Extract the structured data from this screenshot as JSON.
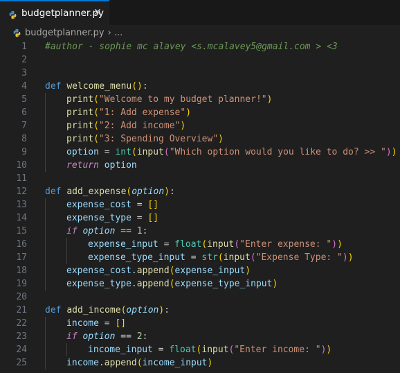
{
  "tab": {
    "filename": "budgetplanner.py",
    "close_glyph": "✕"
  },
  "breadcrumb": {
    "file": "budgetplanner.py",
    "separator": "›",
    "more": "..."
  },
  "editor": {
    "lines": [
      {
        "n": "1",
        "indent": 0,
        "tokens": [
          [
            "cmt",
            "#author - sophie mc alavey <s.mcalavey5@gmail.com > <3"
          ]
        ]
      },
      {
        "n": "2",
        "indent": 0,
        "tokens": []
      },
      {
        "n": "3",
        "indent": 0,
        "tokens": []
      },
      {
        "n": "4",
        "indent": 0,
        "tokens": [
          [
            "kw",
            "def"
          ],
          [
            "",
            " "
          ],
          [
            "fn",
            "welcome_menu"
          ],
          [
            "b1",
            "()"
          ],
          [
            "",
            ":"
          ]
        ]
      },
      {
        "n": "5",
        "indent": 1,
        "tokens": [
          [
            "fn",
            "print"
          ],
          [
            "b1",
            "("
          ],
          [
            "str",
            "\"Welcome to my budget planner!\""
          ],
          [
            "b1",
            ")"
          ]
        ]
      },
      {
        "n": "6",
        "indent": 1,
        "tokens": [
          [
            "fn",
            "print"
          ],
          [
            "b1",
            "("
          ],
          [
            "str",
            "\"1: Add expense\""
          ],
          [
            "b1",
            ")"
          ]
        ]
      },
      {
        "n": "7",
        "indent": 1,
        "tokens": [
          [
            "fn",
            "print"
          ],
          [
            "b1",
            "("
          ],
          [
            "str",
            "\"2: Add income\""
          ],
          [
            "b1",
            ")"
          ]
        ]
      },
      {
        "n": "8",
        "indent": 1,
        "tokens": [
          [
            "fn",
            "print"
          ],
          [
            "b1",
            "("
          ],
          [
            "str",
            "\"3: Spending Overview\""
          ],
          [
            "b1",
            ")"
          ]
        ]
      },
      {
        "n": "9",
        "indent": 1,
        "tokens": [
          [
            "var",
            "option"
          ],
          [
            "",
            " = "
          ],
          [
            "cls",
            "int"
          ],
          [
            "b1",
            "("
          ],
          [
            "fn",
            "input"
          ],
          [
            "b2",
            "("
          ],
          [
            "str",
            "\"Which option would you like to do? >> \""
          ],
          [
            "b2",
            ")"
          ],
          [
            "b1",
            ")"
          ]
        ]
      },
      {
        "n": "10",
        "indent": 1,
        "tokens": [
          [
            "ctl",
            "return"
          ],
          [
            "",
            " "
          ],
          [
            "var",
            "option"
          ]
        ]
      },
      {
        "n": "11",
        "indent": 0,
        "tokens": []
      },
      {
        "n": "12",
        "indent": 0,
        "tokens": [
          [
            "kw",
            "def"
          ],
          [
            "",
            " "
          ],
          [
            "fn",
            "add_expense"
          ],
          [
            "b1",
            "("
          ],
          [
            "param",
            "option"
          ],
          [
            "b1",
            ")"
          ],
          [
            "",
            ":"
          ]
        ]
      },
      {
        "n": "13",
        "indent": 1,
        "tokens": [
          [
            "var",
            "expense_cost"
          ],
          [
            "",
            " = "
          ],
          [
            "b1",
            "[]"
          ]
        ]
      },
      {
        "n": "14",
        "indent": 1,
        "tokens": [
          [
            "var",
            "expense_type"
          ],
          [
            "",
            " = "
          ],
          [
            "b1",
            "[]"
          ]
        ]
      },
      {
        "n": "15",
        "indent": 1,
        "tokens": [
          [
            "ctl",
            "if"
          ],
          [
            "",
            " "
          ],
          [
            "param",
            "option"
          ],
          [
            "",
            " == "
          ],
          [
            "num",
            "1"
          ],
          [
            "",
            ":"
          ]
        ]
      },
      {
        "n": "16",
        "indent": 2,
        "tokens": [
          [
            "var",
            "expense_input"
          ],
          [
            "",
            " = "
          ],
          [
            "cls",
            "float"
          ],
          [
            "b1",
            "("
          ],
          [
            "fn",
            "input"
          ],
          [
            "b2",
            "("
          ],
          [
            "str",
            "\"Enter expense: \""
          ],
          [
            "b2",
            ")"
          ],
          [
            "b1",
            ")"
          ]
        ]
      },
      {
        "n": "17",
        "indent": 2,
        "tokens": [
          [
            "var",
            "expense_type_input"
          ],
          [
            "",
            " = "
          ],
          [
            "cls",
            "str"
          ],
          [
            "b1",
            "("
          ],
          [
            "fn",
            "input"
          ],
          [
            "b2",
            "("
          ],
          [
            "str",
            "\"Expense Type: \""
          ],
          [
            "b2",
            ")"
          ],
          [
            "b1",
            ")"
          ]
        ]
      },
      {
        "n": "18",
        "indent": 1,
        "tokens": [
          [
            "var",
            "expense_cost"
          ],
          [
            "",
            "."
          ],
          [
            "fn",
            "append"
          ],
          [
            "b1",
            "("
          ],
          [
            "var",
            "expense_input"
          ],
          [
            "b1",
            ")"
          ]
        ]
      },
      {
        "n": "19",
        "indent": 1,
        "tokens": [
          [
            "var",
            "expense_type"
          ],
          [
            "",
            "."
          ],
          [
            "fn",
            "append"
          ],
          [
            "b1",
            "("
          ],
          [
            "var",
            "expense_type_input"
          ],
          [
            "b1",
            ")"
          ]
        ]
      },
      {
        "n": "20",
        "indent": 0,
        "tokens": []
      },
      {
        "n": "21",
        "indent": 0,
        "tokens": [
          [
            "kw",
            "def"
          ],
          [
            "",
            " "
          ],
          [
            "fn",
            "add_income"
          ],
          [
            "b1",
            "("
          ],
          [
            "param",
            "option"
          ],
          [
            "b1",
            ")"
          ],
          [
            "",
            ":"
          ]
        ]
      },
      {
        "n": "22",
        "indent": 1,
        "tokens": [
          [
            "var",
            "income"
          ],
          [
            "",
            " = "
          ],
          [
            "b1",
            "[]"
          ]
        ]
      },
      {
        "n": "23",
        "indent": 1,
        "tokens": [
          [
            "ctl",
            "if"
          ],
          [
            "",
            " "
          ],
          [
            "param",
            "option"
          ],
          [
            "",
            " == "
          ],
          [
            "num",
            "2"
          ],
          [
            "",
            ":"
          ]
        ]
      },
      {
        "n": "24",
        "indent": 2,
        "tokens": [
          [
            "var",
            "income_input"
          ],
          [
            "",
            " = "
          ],
          [
            "cls",
            "float"
          ],
          [
            "b1",
            "("
          ],
          [
            "fn",
            "input"
          ],
          [
            "b2",
            "("
          ],
          [
            "str",
            "\"Enter income: \""
          ],
          [
            "b2",
            ")"
          ],
          [
            "b1",
            ")"
          ]
        ]
      },
      {
        "n": "25",
        "indent": 1,
        "tokens": [
          [
            "var",
            "income"
          ],
          [
            "",
            "."
          ],
          [
            "fn",
            "append"
          ],
          [
            "b1",
            "("
          ],
          [
            "var",
            "income_input"
          ],
          [
            "b1",
            ")"
          ]
        ]
      }
    ]
  },
  "colors": {
    "accent": "#0078d4",
    "background": "#1f1f1f",
    "tab_strip": "#181818"
  },
  "icons": {
    "file_type": "python-icon",
    "close": "close-icon"
  }
}
